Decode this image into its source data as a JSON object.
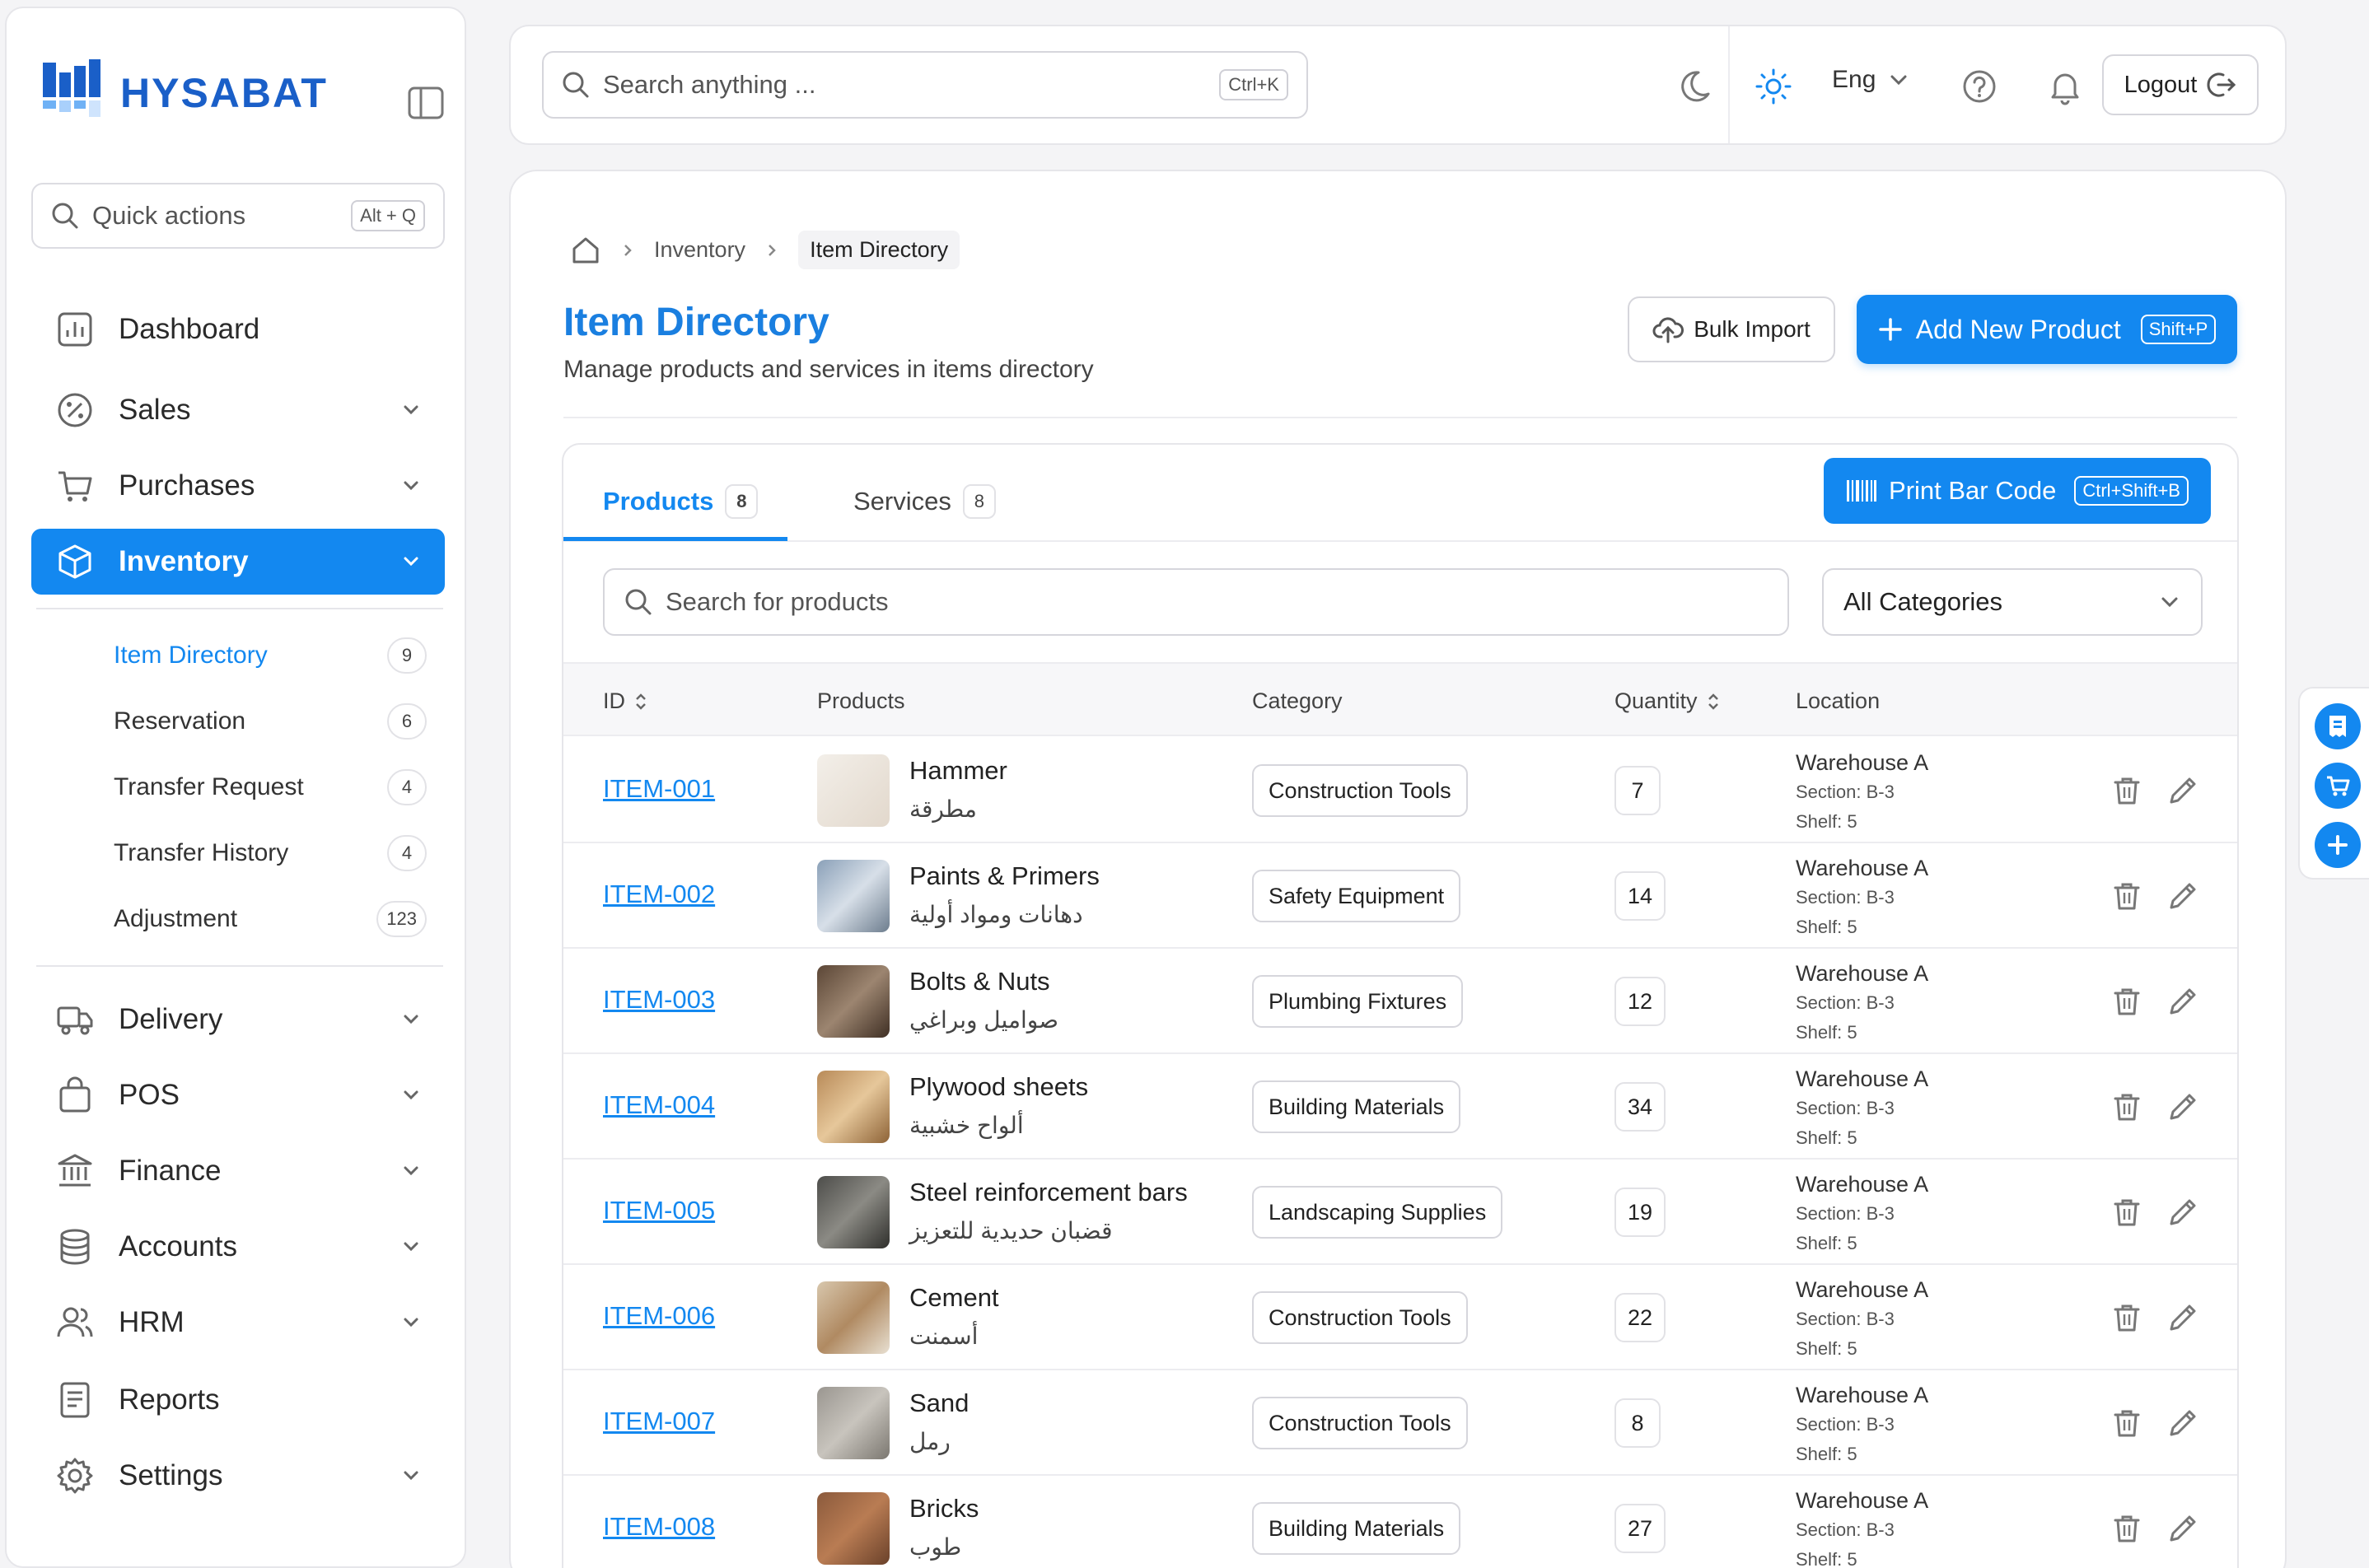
{
  "brand": {
    "name": "HYSABAT"
  },
  "colors": {
    "accent": "#1388f0",
    "title": "#1a7fe0",
    "logo": "#1a5fc8"
  },
  "sidebar": {
    "quick_actions": {
      "label": "Quick actions",
      "shortcut": "Alt + Q"
    },
    "items": [
      {
        "label": "Dashboard",
        "icon": "dashboard-icon"
      },
      {
        "label": "Sales",
        "icon": "percent-icon"
      },
      {
        "label": "Purchases",
        "icon": "cart-icon"
      },
      {
        "label": "Inventory",
        "icon": "box-icon",
        "active": true
      },
      {
        "label": "Delivery",
        "icon": "truck-icon"
      },
      {
        "label": "POS",
        "icon": "bag-icon"
      },
      {
        "label": "Finance",
        "icon": "bank-icon"
      },
      {
        "label": "Accounts",
        "icon": "database-icon"
      },
      {
        "label": "HRM",
        "icon": "users-icon"
      },
      {
        "label": "Reports",
        "icon": "report-icon"
      },
      {
        "label": "Settings",
        "icon": "gear-icon"
      }
    ],
    "sub_items": [
      {
        "label": "Item Directory",
        "count": "9",
        "active": true
      },
      {
        "label": "Reservation",
        "count": "6"
      },
      {
        "label": "Transfer Request",
        "count": "4"
      },
      {
        "label": "Transfer History",
        "count": "4"
      },
      {
        "label": "Adjustment",
        "count": "123"
      }
    ]
  },
  "topbar": {
    "search_placeholder": "Search anything ...",
    "search_shortcut": "Ctrl+K",
    "language": "Eng",
    "logout_label": "Logout"
  },
  "breadcrumb": {
    "parent": "Inventory",
    "current": "Item Directory"
  },
  "page": {
    "title": "Item Directory",
    "subtitle": "Manage products and services in items directory",
    "bulk_import_label": "Bulk Import",
    "add_label": "Add New Product",
    "add_shortcut": "Shift+P"
  },
  "tabs": [
    {
      "label": "Products",
      "count": "8",
      "active": true
    },
    {
      "label": "Services",
      "count": "8"
    }
  ],
  "print": {
    "label": "Print Bar Code",
    "shortcut": "Ctrl+Shift+B"
  },
  "filters": {
    "search_placeholder": "Search for products",
    "category": "All Categories"
  },
  "table": {
    "headers": {
      "id": "ID",
      "products": "Products",
      "category": "Category",
      "quantity": "Quantity",
      "location": "Location"
    },
    "rows": [
      {
        "id": "ITEM-001",
        "name": "Hammer",
        "name_ar": "مطرقة",
        "category": "Construction Tools",
        "qty": "7",
        "warehouse": "Warehouse A",
        "section": "Section: B-3",
        "shelf": "Shelf: 5"
      },
      {
        "id": "ITEM-002",
        "name": "Paints & Primers",
        "name_ar": "دهانات ومواد أولية",
        "category": "Safety Equipment",
        "qty": "14",
        "warehouse": "Warehouse A",
        "section": "Section: B-3",
        "shelf": "Shelf: 5"
      },
      {
        "id": "ITEM-003",
        "name": "Bolts & Nuts",
        "name_ar": "صواميل وبراغي",
        "category": "Plumbing Fixtures",
        "qty": "12",
        "warehouse": "Warehouse A",
        "section": "Section: B-3",
        "shelf": "Shelf: 5"
      },
      {
        "id": "ITEM-004",
        "name": "Plywood sheets",
        "name_ar": "ألواح خشبية",
        "category": "Building Materials",
        "qty": "34",
        "warehouse": "Warehouse A",
        "section": "Section: B-3",
        "shelf": "Shelf: 5"
      },
      {
        "id": "ITEM-005",
        "name": "Steel reinforcement bars",
        "name_ar": "قضبان حديدية للتعزيز",
        "category": "Landscaping Supplies",
        "qty": "19",
        "warehouse": "Warehouse A",
        "section": "Section: B-3",
        "shelf": "Shelf: 5"
      },
      {
        "id": "ITEM-006",
        "name": "Cement",
        "name_ar": "أسمنت",
        "category": "Construction Tools",
        "qty": "22",
        "warehouse": "Warehouse A",
        "section": "Section: B-3",
        "shelf": "Shelf: 5"
      },
      {
        "id": "ITEM-007",
        "name": "Sand",
        "name_ar": "رمل",
        "category": "Construction Tools",
        "qty": "8",
        "warehouse": "Warehouse A",
        "section": "Section: B-3",
        "shelf": "Shelf: 5"
      },
      {
        "id": "ITEM-008",
        "name": "Bricks",
        "name_ar": "طوب",
        "category": "Building Materials",
        "qty": "27",
        "warehouse": "Warehouse A",
        "section": "Section: B-3",
        "shelf": "Shelf: 5"
      }
    ]
  }
}
